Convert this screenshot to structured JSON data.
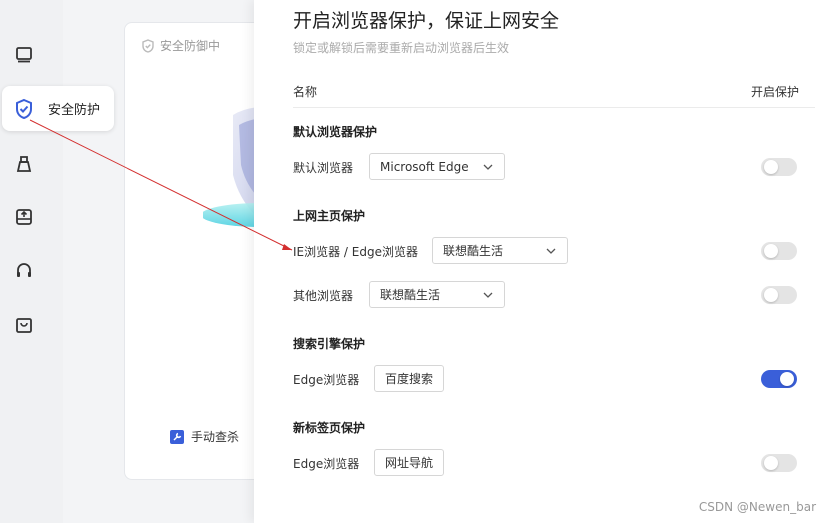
{
  "sidebar": {
    "items": [
      {
        "icon": "monitor-icon"
      },
      {
        "icon": "shield-check-icon",
        "label": "安全防护",
        "active": true
      },
      {
        "icon": "broom-icon"
      },
      {
        "icon": "drive-upload-icon"
      },
      {
        "icon": "headset-icon"
      },
      {
        "icon": "shopping-bag-icon"
      }
    ]
  },
  "background_card": {
    "status": "安全防御中",
    "manual_scan_label": "手动查杀"
  },
  "drawer": {
    "title": "开启浏览器保护，保证上网安全",
    "subtitle": "锁定或解锁后需要重新启动浏览器后生效",
    "col_name": "名称",
    "col_protect": "开启保护",
    "sections": [
      {
        "title": "默认浏览器保护",
        "rows": [
          {
            "label": "默认浏览器",
            "control": "select",
            "value": "Microsoft Edge",
            "on": false
          }
        ]
      },
      {
        "title": "上网主页保护",
        "rows": [
          {
            "label": "IE浏览器 / Edge浏览器",
            "control": "select",
            "value": "联想酷生活",
            "on": false
          },
          {
            "label": "其他浏览器",
            "control": "select",
            "value": "联想酷生活",
            "on": false
          }
        ]
      },
      {
        "title": "搜索引擎保护",
        "rows": [
          {
            "label": "Edge浏览器",
            "control": "button",
            "value": "百度搜索",
            "on": true
          }
        ]
      },
      {
        "title": "新标签页保护",
        "rows": [
          {
            "label": "Edge浏览器",
            "control": "button",
            "value": "网址导航",
            "on": false
          }
        ]
      }
    ]
  },
  "watermark": "CSDN @Newen_bar",
  "colors": {
    "accent": "#3a5fd9",
    "annotation": "#d32f2f"
  }
}
